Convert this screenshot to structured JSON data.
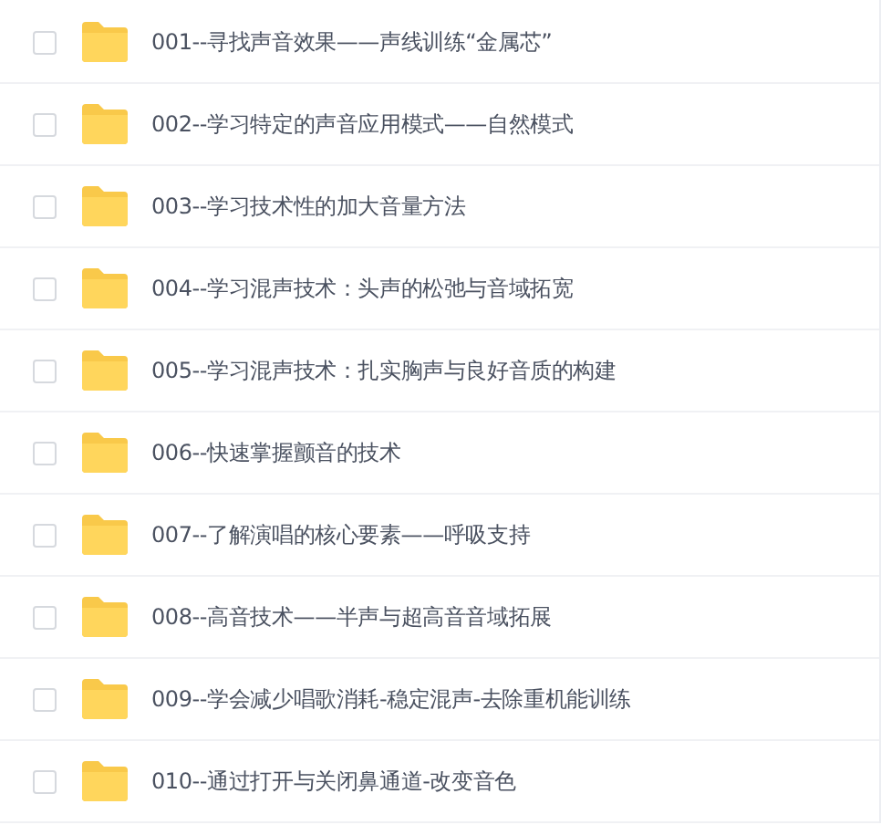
{
  "files": [
    {
      "name": "001--寻找声音效果——声线训练“金属芯”",
      "checked": false
    },
    {
      "name": "002--学习特定的声音应用模式——自然模式",
      "checked": false
    },
    {
      "name": "003--学习技术性的加大音量方法",
      "checked": false
    },
    {
      "name": "004--学习混声技术：头声的松弛与音域拓宽",
      "checked": false
    },
    {
      "name": "005--学习混声技术：扎实胸声与良好音质的构建",
      "checked": false
    },
    {
      "name": "006--快速掌握颤音的技术",
      "checked": false
    },
    {
      "name": "007--了解演唱的核心要素——呼吸支持",
      "checked": false
    },
    {
      "name": "008--高音技术——半声与超高音音域拓展",
      "checked": false
    },
    {
      "name": "009--学会减少唱歌消耗-稳定混声-去除重机能训练",
      "checked": false
    },
    {
      "name": "010--通过打开与关闭鼻通道-改变音色",
      "checked": false
    }
  ]
}
